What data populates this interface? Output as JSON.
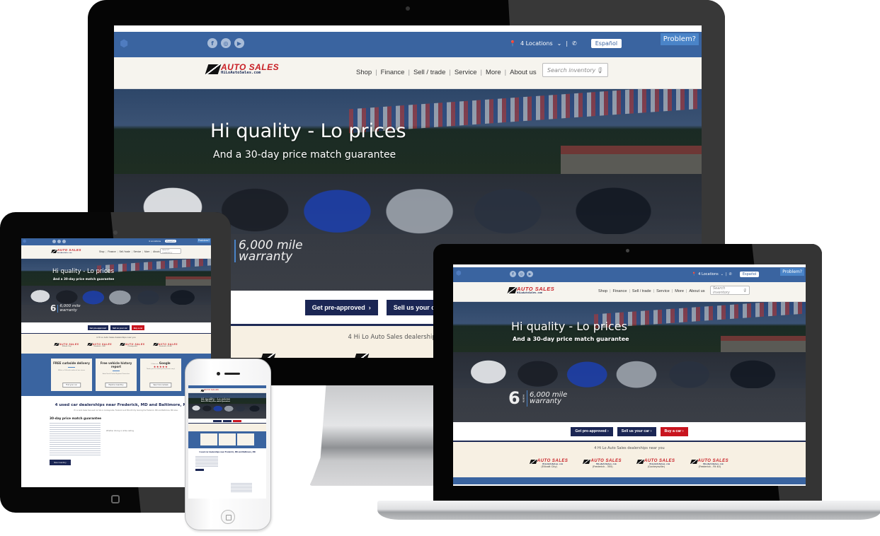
{
  "site": {
    "topbar": {
      "social_icons": [
        "facebook-icon",
        "instagram-icon",
        "youtube-icon"
      ],
      "locations_label": "4 Locations",
      "language_button": "Español",
      "problem_button": "Problem?"
    },
    "logo": {
      "brand": "AUTO SALES",
      "url": "HiLoAutoSales.com"
    },
    "nav": {
      "items": [
        "Shop",
        "Finance",
        "Sell / trade",
        "Service",
        "More",
        "About us"
      ]
    },
    "search": {
      "placeholder": "Search inventory"
    },
    "hero": {
      "headline": "Hi quality - Lo prices",
      "subheadline": "And a 30-day price match guarantee",
      "warranty_number": "6",
      "warranty_unit": "MONTH",
      "warranty_line1": "6,000 mile",
      "warranty_line2": "warranty"
    },
    "cta": {
      "buttons": [
        {
          "label": "Get pre-approved",
          "style": "navy"
        },
        {
          "label": "Sell us your car",
          "style": "navy"
        },
        {
          "label": "Buy a car",
          "style": "red"
        }
      ]
    },
    "dealerships": {
      "heading": "4 Hi Lo Auto Sales dealerships near you",
      "locations": [
        "(Ellicott City)",
        "(Frederick - 355)",
        "(Cockeysville)",
        "(Frederick - Rt 40)"
      ]
    },
    "features": [
      {
        "title": "FREE curbside delivery",
        "text": "Within a 100-mile radius of our stores",
        "button": "Find your car"
      },
      {
        "title": "Free vehicle history report",
        "text": "AutoCheck/Carfax Buyback Protection",
        "button": "Explore inventory"
      },
      {
        "title": "Google",
        "prefix": "5 Stars on",
        "stars": "★★★★★",
        "text": "Thank you for making this process easy!",
        "button": "See more reviews"
      }
    ],
    "about": {
      "heading": "4 used car dealerships near Frederick, MD and Baltimore, MD",
      "subtext": "Hi Lo Auto Sales has used car lots in Cockeysville, Frederick and Ellicott City. Serving the Frederick, MD and Baltimore, MD area.",
      "section_title": "30-day price match guarantee",
      "video_caption": "Whether driving or while visiting",
      "button": "New inventory"
    }
  },
  "colors": {
    "topbar_blue": "#3a64a0",
    "navy": "#1b2654",
    "red": "#c8141e",
    "cream": "#f7f0e3"
  }
}
